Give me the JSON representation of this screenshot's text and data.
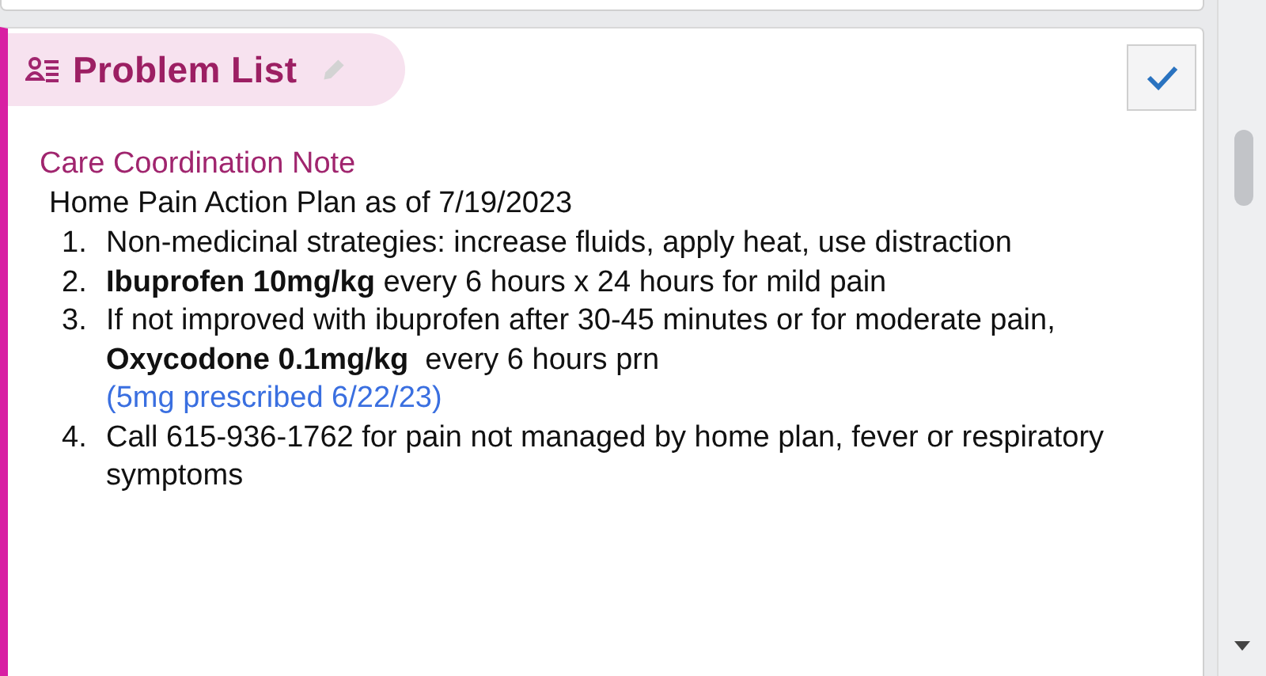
{
  "panel": {
    "title": "Problem List"
  },
  "note": {
    "heading": "Care Coordination Note",
    "title": "Home Pain Action Plan as of 7/19/2023",
    "items": [
      {
        "number": "1.",
        "text": "Non-medicinal strategies: increase fluids, apply heat, use distraction"
      },
      {
        "number": "2.",
        "text": "**Ibuprofen 10mg/kg** every 6 hours x 24 hours for mild pain"
      },
      {
        "number": "3.",
        "text": "If not improved with ibuprofen after 30-45 minutes or for moderate pain, **Oxycodone 0.1mg/kg**  every 6 hours prn",
        "note": "(5mg prescribed 6/22/23)"
      },
      {
        "number": "4.",
        "text": "Call 615-936-1762 for pain not managed by home plan, fever or respiratory symptoms"
      }
    ]
  }
}
